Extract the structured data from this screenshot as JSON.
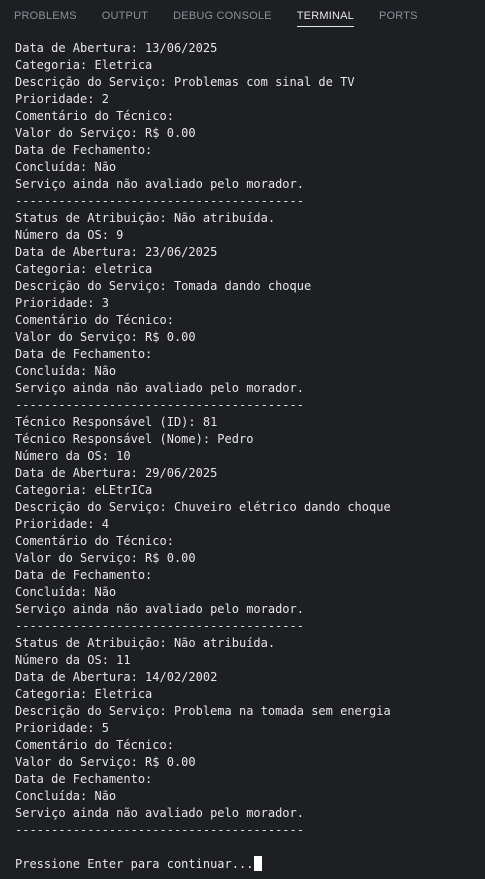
{
  "panel": {
    "tabs": [
      {
        "label": "PROBLEMS",
        "active": false
      },
      {
        "label": "OUTPUT",
        "active": false
      },
      {
        "label": "DEBUG CONSOLE",
        "active": false
      },
      {
        "label": "TERMINAL",
        "active": true
      },
      {
        "label": "PORTS",
        "active": false
      }
    ]
  },
  "terminal": {
    "lines": [
      "Data de Abertura: 13/06/2025",
      "Categoria: Eletrica",
      "Descrição do Serviço: Problemas com sinal de TV",
      "Prioridade: 2",
      "Comentário do Técnico:",
      "Valor do Serviço: R$ 0.00",
      "Data de Fechamento:",
      "Concluída: Não",
      "Serviço ainda não avaliado pelo morador.",
      "----------------------------------------",
      "Status de Atribuição: Não atribuída.",
      "Número da OS: 9",
      "Data de Abertura: 23/06/2025",
      "Categoria: eletrica",
      "Descrição do Serviço: Tomada dando choque",
      "Prioridade: 3",
      "Comentário do Técnico:",
      "Valor do Serviço: R$ 0.00",
      "Data de Fechamento:",
      "Concluída: Não",
      "Serviço ainda não avaliado pelo morador.",
      "----------------------------------------",
      "Técnico Responsável (ID): 81",
      "Técnico Responsável (Nome): Pedro",
      "Número da OS: 10",
      "Data de Abertura: 29/06/2025",
      "Categoria: eLEtrICa",
      "Descrição do Serviço: Chuveiro elétrico dando choque",
      "Prioridade: 4",
      "Comentário do Técnico:",
      "Valor do Serviço: R$ 0.00",
      "Data de Fechamento:",
      "Concluída: Não",
      "Serviço ainda não avaliado pelo morador.",
      "----------------------------------------",
      "Status de Atribuição: Não atribuída.",
      "Número da OS: 11",
      "Data de Abertura: 14/02/2002",
      "Categoria: Eletrica",
      "Descrição do Serviço: Problema na tomada sem energia",
      "Prioridade: 5",
      "Comentário do Técnico:",
      "Valor do Serviço: R$ 0.00",
      "Data de Fechamento:",
      "Concluída: Não",
      "Serviço ainda não avaliado pelo morador.",
      "----------------------------------------",
      ""
    ],
    "prompt": "Pressione Enter para continuar..."
  }
}
